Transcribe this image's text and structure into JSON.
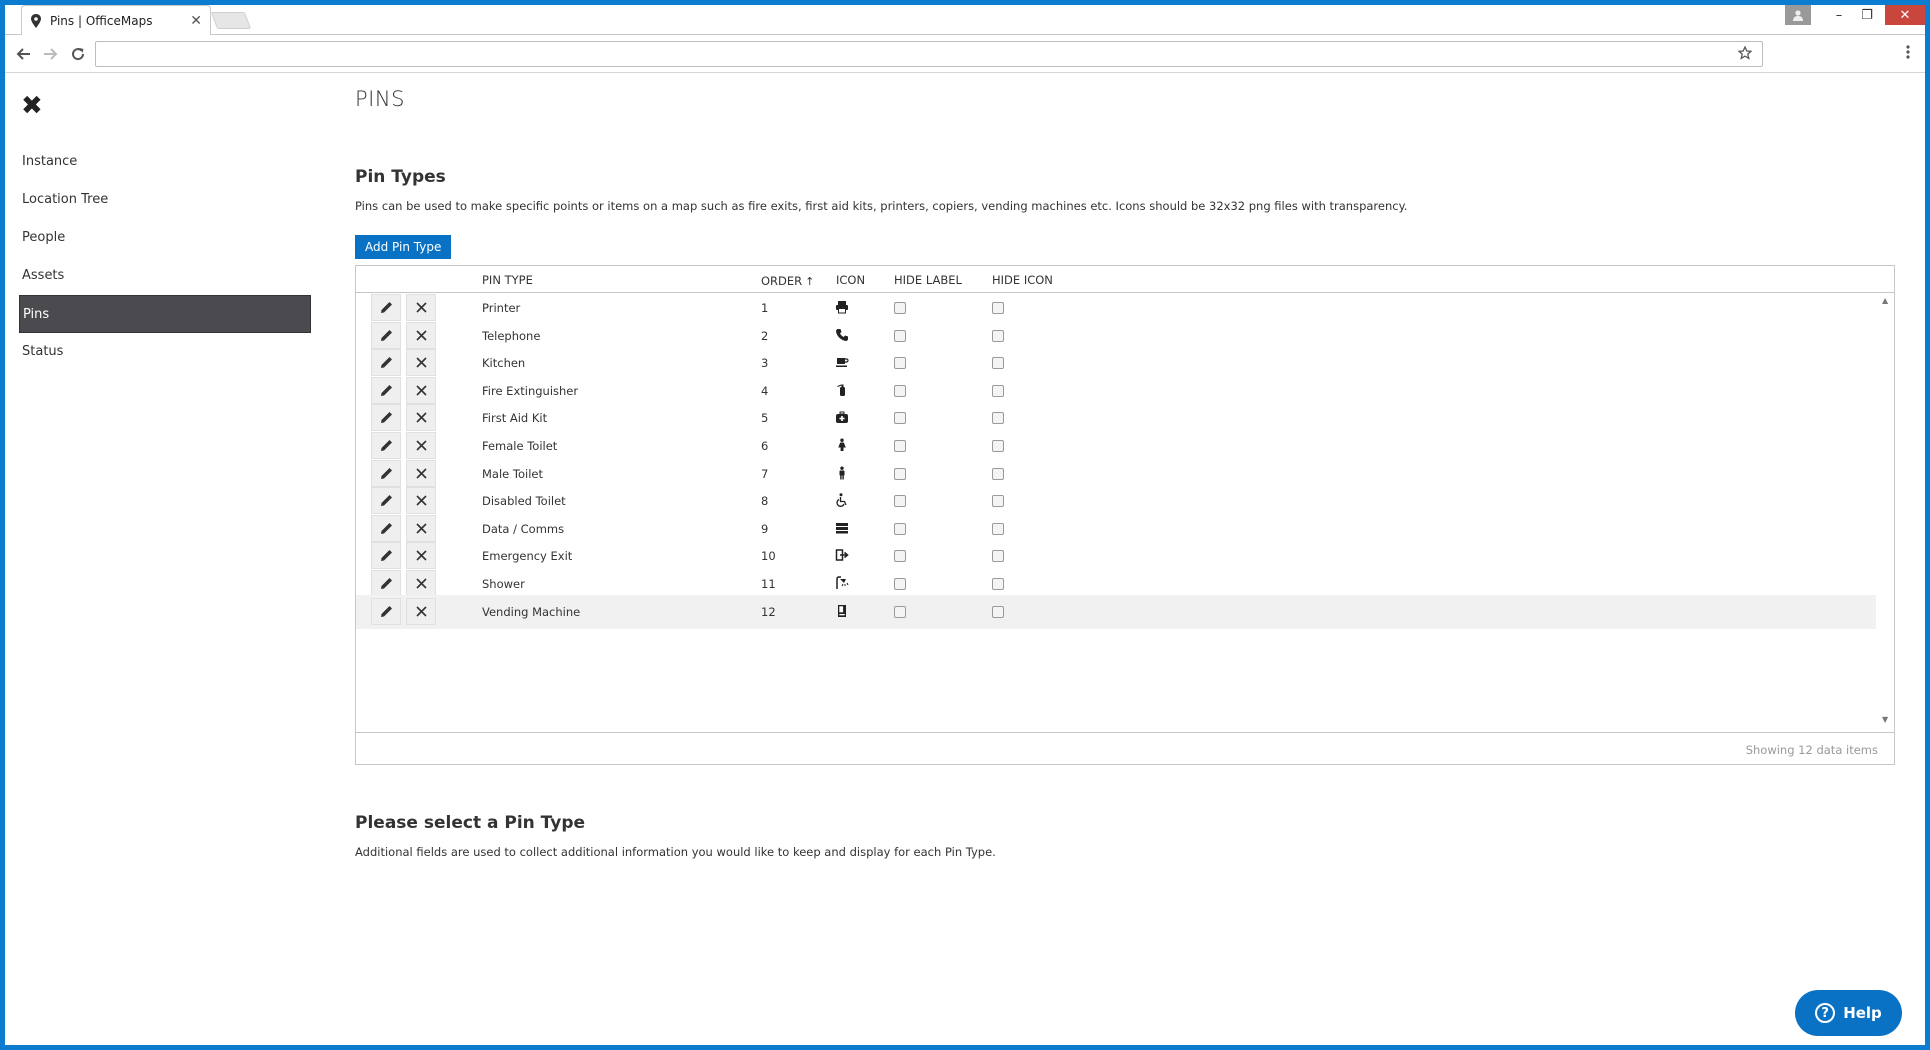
{
  "browser": {
    "tab_title": "Pins | OfficeMaps",
    "tab_close": "✕",
    "omnibox_value": "",
    "win_min": "–",
    "win_max": "❐",
    "win_close": "✕"
  },
  "sidebar": {
    "close_glyph": "✖",
    "items": [
      {
        "label": "Instance"
      },
      {
        "label": "Location Tree"
      },
      {
        "label": "People"
      },
      {
        "label": "Assets"
      },
      {
        "label": "Pins",
        "active": true
      },
      {
        "label": "Status"
      }
    ]
  },
  "main": {
    "page_title": "PINS",
    "section_title": "Pin Types",
    "section_desc": "Pins can be used to make specific points or items on a map such as fire exits, first aid kits, printers, copiers, vending machines etc. Icons should be 32x32 png files with transparency.",
    "add_button": "Add Pin Type"
  },
  "grid": {
    "headers": {
      "pin_type": "PIN TYPE",
      "order": "ORDER",
      "order_sort": "↑",
      "icon": "ICON",
      "hide_label": "HIDE LABEL",
      "hide_icon": "HIDE ICON"
    },
    "rows": [
      {
        "name": "Printer",
        "order": "1",
        "icon": "printer-icon"
      },
      {
        "name": "Telephone",
        "order": "2",
        "icon": "phone-icon"
      },
      {
        "name": "Kitchen",
        "order": "3",
        "icon": "coffee-icon"
      },
      {
        "name": "Fire Extinguisher",
        "order": "4",
        "icon": "fire-extinguisher-icon"
      },
      {
        "name": "First Aid Kit",
        "order": "5",
        "icon": "medkit-icon"
      },
      {
        "name": "Female Toilet",
        "order": "6",
        "icon": "female-icon"
      },
      {
        "name": "Male Toilet",
        "order": "7",
        "icon": "male-icon"
      },
      {
        "name": "Disabled Toilet",
        "order": "8",
        "icon": "wheelchair-icon"
      },
      {
        "name": "Data / Comms",
        "order": "9",
        "icon": "server-icon"
      },
      {
        "name": "Emergency Exit",
        "order": "10",
        "icon": "exit-icon"
      },
      {
        "name": "Shower",
        "order": "11",
        "icon": "shower-icon"
      },
      {
        "name": "Vending Machine",
        "order": "12",
        "icon": "vending-machine-icon",
        "hover": true
      }
    ],
    "footer_count": "Showing 12 data items"
  },
  "select_section": {
    "title": "Please select a Pin Type",
    "desc": "Additional fields are used to collect additional information you would like to keep and display for each Pin Type."
  },
  "help": {
    "label": "Help",
    "glyph": "?"
  },
  "colors": {
    "accent": "#0a72c4",
    "frame": "#0a7dd0",
    "active_nav": "#4a4a4f",
    "win_close": "#c9463d"
  }
}
